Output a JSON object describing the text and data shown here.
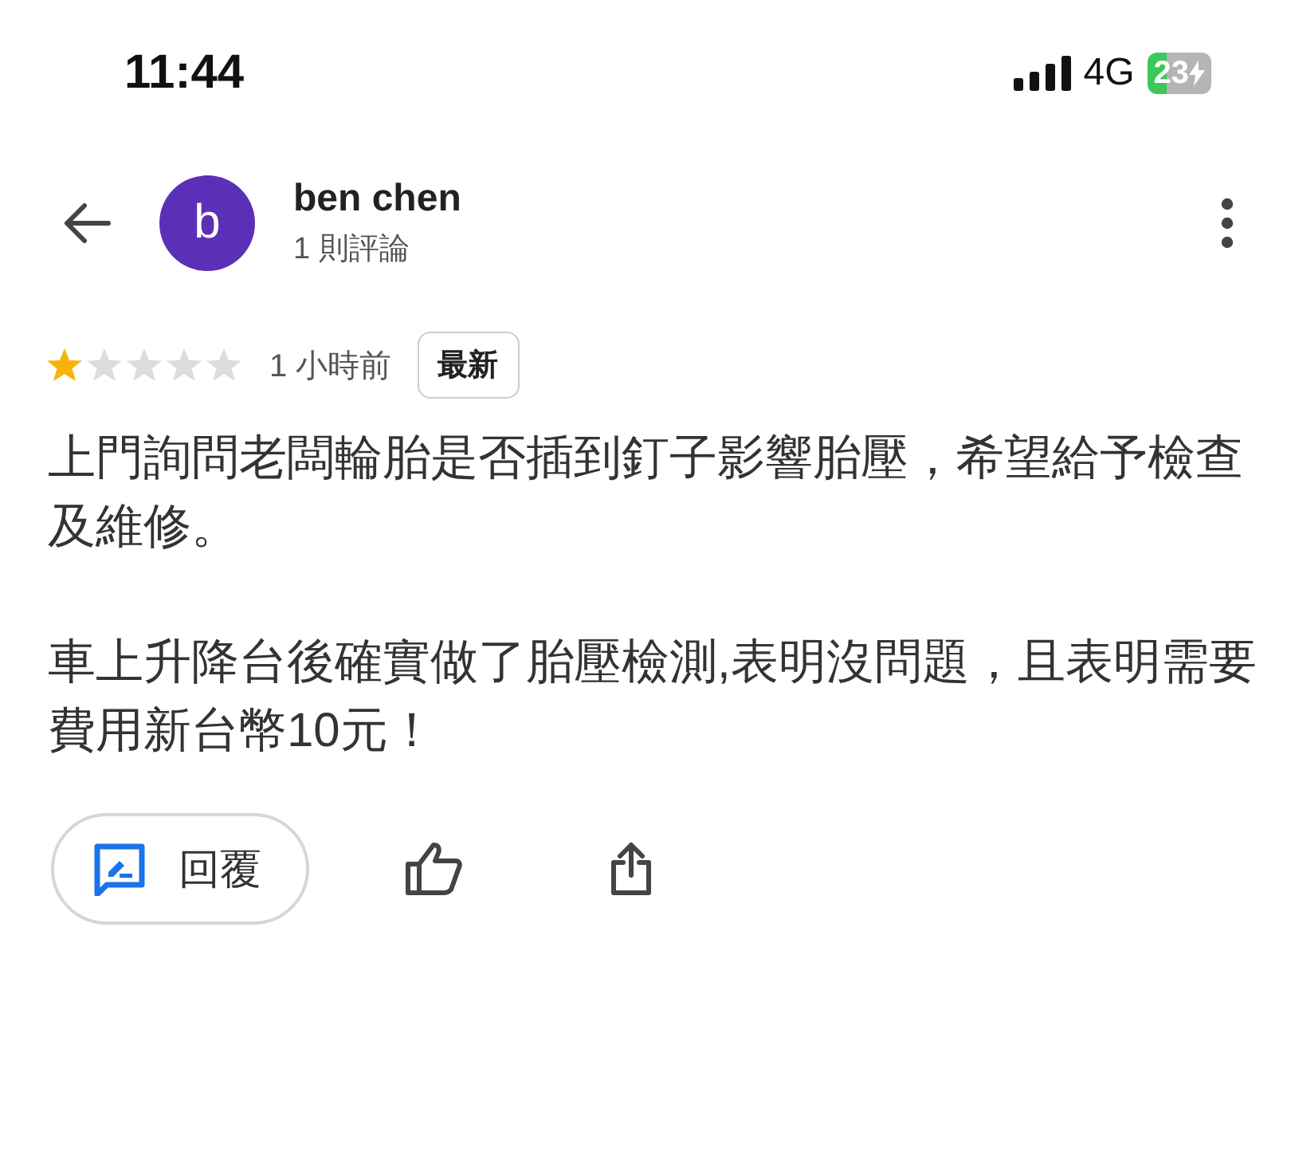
{
  "status_bar": {
    "time": "11:44",
    "network": "4G",
    "battery": "23"
  },
  "header": {
    "avatar_letter": "b",
    "name": "ben chen",
    "subtitle": "1 則評論"
  },
  "review": {
    "stars": 1,
    "time": "1 小時前",
    "badge": "最新",
    "paragraphs": [
      "上門詢問老闆輪胎是否插到釘子影響胎壓，希望給予檢查及維修。",
      "車上升降台後確實做了胎壓檢測,表明沒問題，且表明需要費用新台幣10元！"
    ]
  },
  "actions": {
    "reply": "回覆"
  }
}
